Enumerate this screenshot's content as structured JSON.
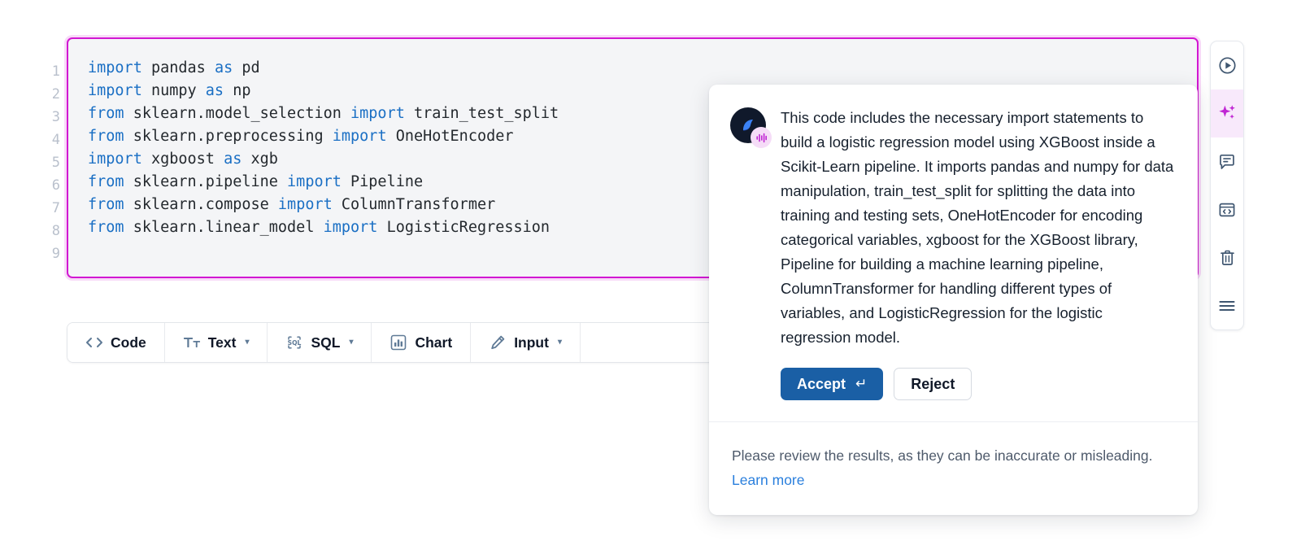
{
  "notebook": {
    "line_numbers": [
      "1",
      "2",
      "3",
      "4",
      "5",
      "6",
      "7",
      "8",
      "9"
    ],
    "code_lines": [
      [
        {
          "t": "import",
          "k": true
        },
        {
          "t": " pandas ",
          "k": false
        },
        {
          "t": "as",
          "k": true
        },
        {
          "t": " pd",
          "k": false
        }
      ],
      [
        {
          "t": "import",
          "k": true
        },
        {
          "t": " numpy ",
          "k": false
        },
        {
          "t": "as",
          "k": true
        },
        {
          "t": " np",
          "k": false
        }
      ],
      [
        {
          "t": "from",
          "k": true
        },
        {
          "t": " sklearn.model_selection ",
          "k": false
        },
        {
          "t": "import",
          "k": true
        },
        {
          "t": " train_test_split",
          "k": false
        }
      ],
      [
        {
          "t": "from",
          "k": true
        },
        {
          "t": " sklearn.preprocessing ",
          "k": false
        },
        {
          "t": "import",
          "k": true
        },
        {
          "t": " OneHotEncoder",
          "k": false
        }
      ],
      [
        {
          "t": "import",
          "k": true
        },
        {
          "t": " xgboost ",
          "k": false
        },
        {
          "t": "as",
          "k": true
        },
        {
          "t": " xgb",
          "k": false
        }
      ],
      [
        {
          "t": "from",
          "k": true
        },
        {
          "t": " sklearn.pipeline ",
          "k": false
        },
        {
          "t": "import",
          "k": true
        },
        {
          "t": " Pipeline",
          "k": false
        }
      ],
      [
        {
          "t": "from",
          "k": true
        },
        {
          "t": " sklearn.compose ",
          "k": false
        },
        {
          "t": "import",
          "k": true
        },
        {
          "t": " ColumnTransformer",
          "k": false
        }
      ],
      [
        {
          "t": "from",
          "k": true
        },
        {
          "t": " sklearn.linear_model ",
          "k": false
        },
        {
          "t": "import",
          "k": true
        },
        {
          "t": " LogisticRegression",
          "k": false
        }
      ],
      []
    ],
    "cell_border_color": "#d217d2"
  },
  "toolbar": {
    "items": [
      {
        "label": "Code",
        "icon": "code-brackets-icon",
        "caret": false
      },
      {
        "label": "Text",
        "icon": "text-format-icon",
        "caret": true
      },
      {
        "label": "SQL",
        "icon": "sql-icon",
        "caret": true
      },
      {
        "label": "Chart",
        "icon": "bar-chart-icon",
        "caret": false
      },
      {
        "label": "Input",
        "icon": "pencil-icon",
        "caret": true
      }
    ],
    "caret_glyph": "▾"
  },
  "ai_popup": {
    "avatar_icon": "assistant-avatar-icon",
    "badge_icon": "audio-waveform-icon",
    "message": "This code includes the necessary import statements to build a logistic regression model using XGBoost inside a Scikit-Learn pipeline. It imports pandas and numpy for data manipulation, train_test_split for splitting the data into training and testing sets, OneHotEncoder for encoding categorical variables, xgboost for the XGBoost library, Pipeline for building a machine learning pipeline, ColumnTransformer for handling different types of variables, and LogisticRegression for the logistic regression model.",
    "accept_label": "Accept",
    "accept_shortcut": "↵",
    "reject_label": "Reject",
    "disclaimer": "Please review the results, as they can be inaccurate or misleading. ",
    "learn_more_label": "Learn more",
    "accept_color": "#1a5fa5",
    "link_color": "#2a7fdd"
  },
  "right_rail": {
    "items": [
      {
        "icon": "run-play-circle-icon",
        "active": false
      },
      {
        "icon": "ai-sparkles-icon",
        "active": true
      },
      {
        "icon": "comment-icon",
        "active": false
      },
      {
        "icon": "code-window-icon",
        "active": false
      },
      {
        "icon": "trash-icon",
        "active": false
      },
      {
        "icon": "menu-hamburger-icon",
        "active": false
      }
    ],
    "active_color": "#c026d3"
  }
}
